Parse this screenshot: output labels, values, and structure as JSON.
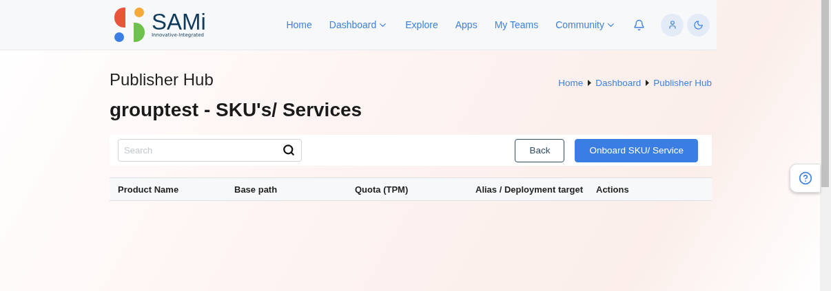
{
  "header": {
    "logo": {
      "name": "SAMi",
      "tagline": "Innovative-Integrated"
    },
    "nav": [
      {
        "label": "Home",
        "dropdown": false
      },
      {
        "label": "Dashboard",
        "dropdown": true
      },
      {
        "label": "Explore",
        "dropdown": false
      },
      {
        "label": "Apps",
        "dropdown": false
      },
      {
        "label": "My Teams",
        "dropdown": false
      },
      {
        "label": "Community",
        "dropdown": true
      }
    ]
  },
  "page": {
    "title": "Publisher Hub",
    "breadcrumbs": [
      "Home",
      "Dashboard",
      "Publisher Hub"
    ],
    "subtitle": "grouptest - SKU's/ Services"
  },
  "search": {
    "placeholder": "Search"
  },
  "buttons": [
    {
      "label": "Back",
      "kind": "outline"
    },
    {
      "label": "Onboard SKU/ Service",
      "kind": "primary"
    }
  ],
  "table": {
    "columns": [
      "Product Name",
      "Base path",
      "Quota (TPM)",
      "Alias / Deployment target",
      "Actions"
    ]
  }
}
